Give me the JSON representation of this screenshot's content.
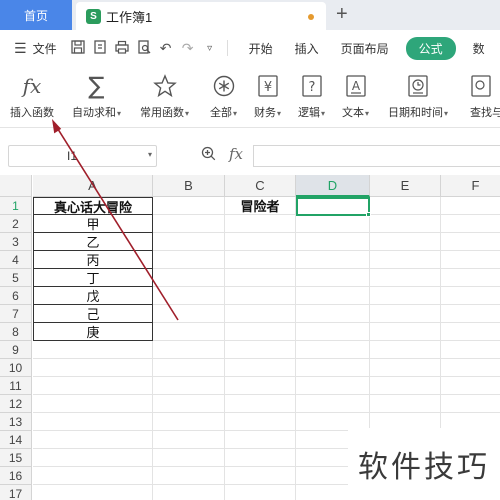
{
  "tabs": {
    "home_label": "首页",
    "doc_icon": "S",
    "doc_title": "工作簿1",
    "new_tab": "+"
  },
  "menubar": {
    "file_label": "文件",
    "tabs": [
      "开始",
      "插入",
      "页面布局",
      "公式",
      "数"
    ],
    "active_tab": "公式"
  },
  "ribbon": {
    "insert_function": "插入函数",
    "autosum": "自动求和",
    "common_functions": "常用函数",
    "all": "全部",
    "finance": "财务",
    "logic": "逻辑",
    "text": "文本",
    "datetime": "日期和时间",
    "lookup": "查找与"
  },
  "formula_bar": {
    "name_box": "I1",
    "fx": "fx",
    "formula": ""
  },
  "grid": {
    "columns": [
      "A",
      "B",
      "C",
      "D",
      "E",
      "F"
    ],
    "selected_column": "D",
    "rows": [
      "1",
      "2",
      "3",
      "4",
      "5",
      "6",
      "7",
      "8",
      "9",
      "10",
      "11",
      "12",
      "13",
      "14",
      "15",
      "16",
      "17"
    ],
    "selected_row": "1",
    "cells": {
      "A1": "真心话大冒险",
      "A2": "甲",
      "A3": "乙",
      "A4": "丙",
      "A5": "丁",
      "A6": "戊",
      "A7": "己",
      "A8": "庚",
      "C1": "冒险者"
    }
  },
  "watermark": "软件技巧",
  "colors": {
    "accent_green": "#21a366",
    "home_tab_blue": "#4a86e8",
    "annotation_arrow": "#a01f2b"
  }
}
